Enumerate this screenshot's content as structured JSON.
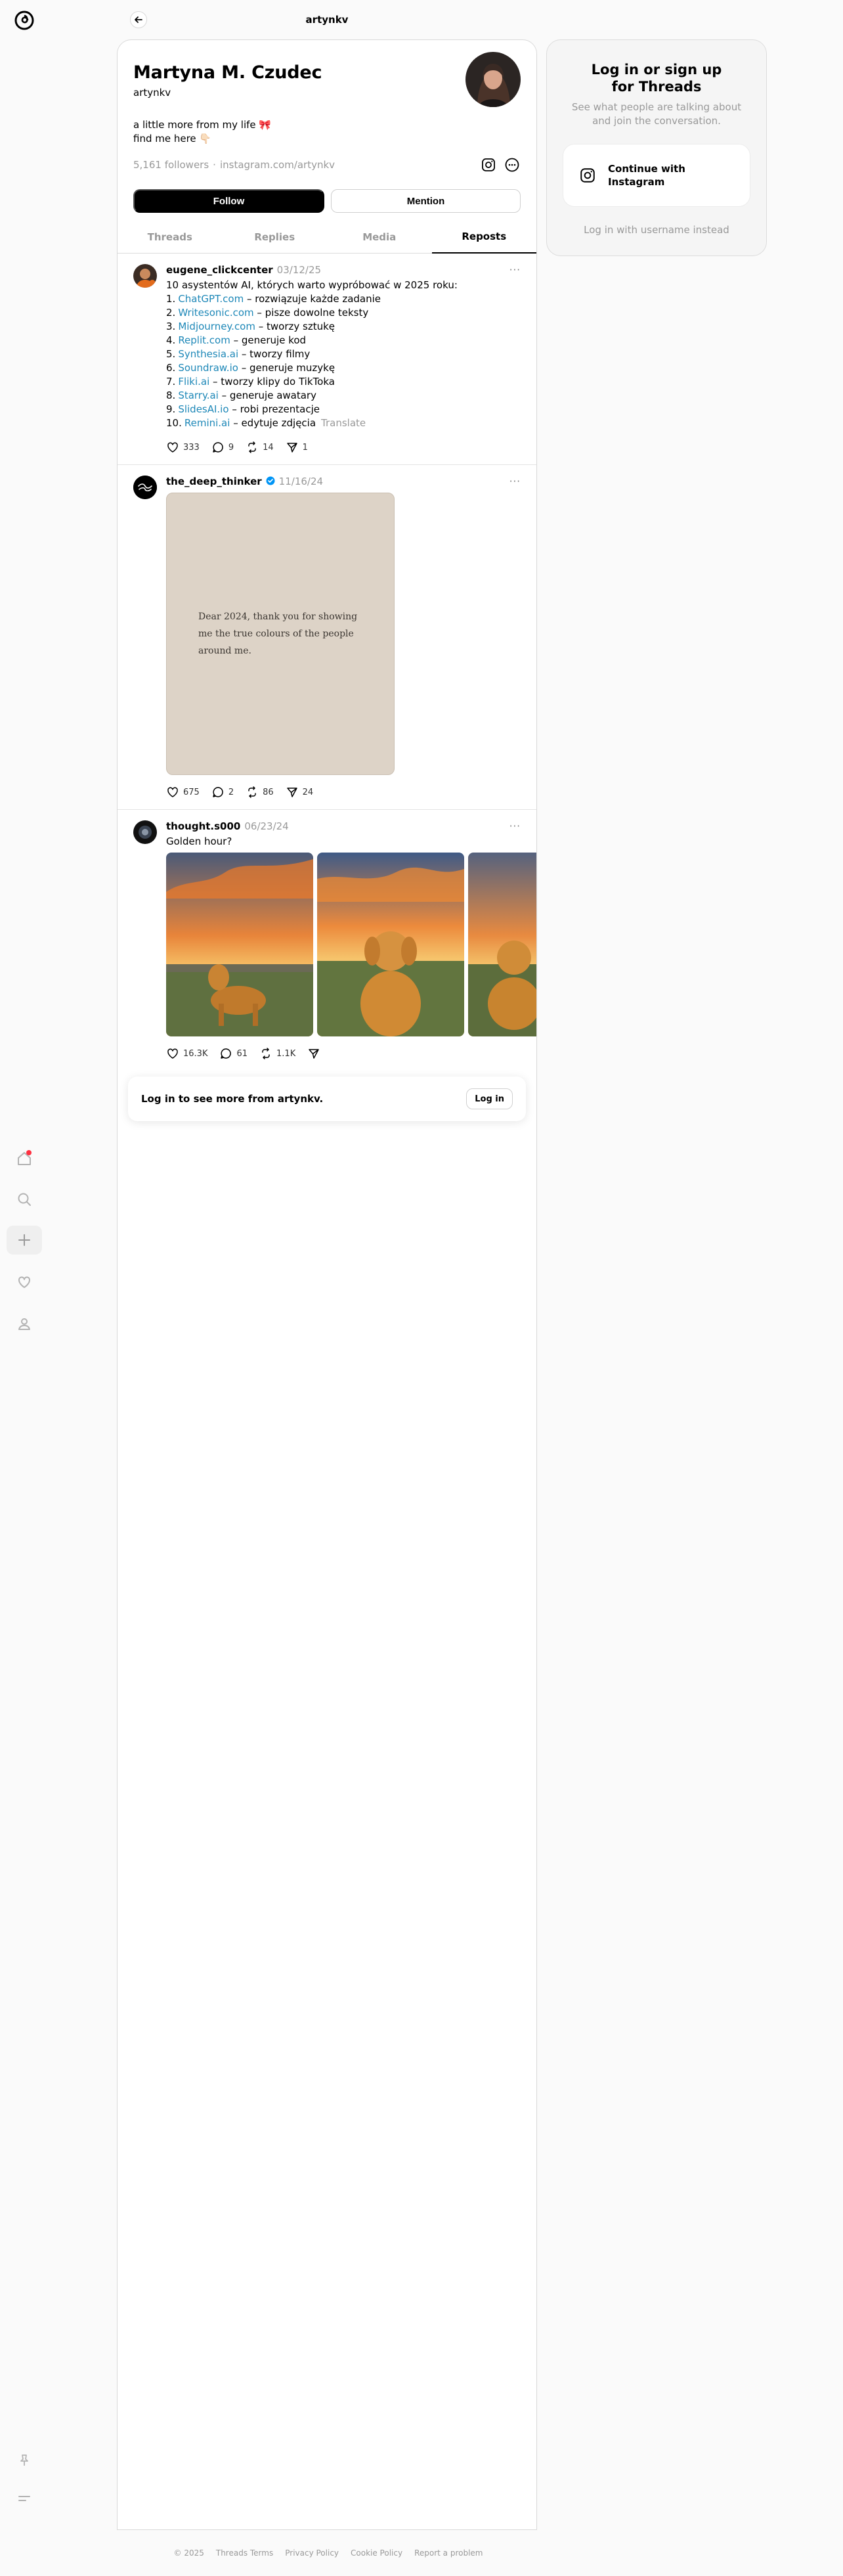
{
  "topbar": {
    "title": "artynkv"
  },
  "profile": {
    "name": "Martyna M. Czudec",
    "handle": "artynkv",
    "bio": "a little more from my life 🎀\nfind me here 👇🏻",
    "followers": "5,161 followers",
    "separator": "·",
    "link": "instagram.com/artynkv",
    "follow_label": "Follow",
    "mention_label": "Mention"
  },
  "tabs": [
    {
      "label": "Threads"
    },
    {
      "label": "Replies"
    },
    {
      "label": "Media"
    },
    {
      "label": "Reposts"
    }
  ],
  "posts": [
    {
      "author": "eugene_clickcenter",
      "date": "03/12/25",
      "more": "···",
      "intro": "10 asystentów AI, których warto wypróbować w 2025 roku:",
      "items": [
        {
          "num": "1.",
          "link": "ChatGPT.com",
          "desc": " – rozwiązuje każde zadanie"
        },
        {
          "num": "2.",
          "link": "Writesonic.com",
          "desc": " – pisze dowolne teksty"
        },
        {
          "num": "3.",
          "link": "Midjourney.com",
          "desc": " – tworzy sztukę"
        },
        {
          "num": "4.",
          "link": "Replit.com",
          "desc": " – generuje kod"
        },
        {
          "num": "5.",
          "link": "Synthesia.ai",
          "desc": " – tworzy filmy"
        },
        {
          "num": "6.",
          "link": "Soundraw.io",
          "desc": " – generuje muzykę"
        },
        {
          "num": "7.",
          "link": "Fliki.ai",
          "desc": " – tworzy klipy do TikToka"
        },
        {
          "num": "8.",
          "link": "Starry.ai",
          "desc": " – generuje awatary"
        },
        {
          "num": "9.",
          "link": "SlidesAI.io",
          "desc": " – robi prezentacje"
        },
        {
          "num": "10.",
          "link": "Remini.ai",
          "desc": " – edytuje zdjęcia"
        }
      ],
      "translate": "Translate",
      "likes": "333",
      "replies": "9",
      "reposts": "14",
      "shares": "1"
    },
    {
      "author": "the_deep_thinker",
      "date": "11/16/24",
      "more": "···",
      "image_text": "Dear 2024, thank you for showing me the true colours of the people around me.",
      "likes": "675",
      "replies": "2",
      "reposts": "86",
      "shares": "24"
    },
    {
      "author": "thought.s000",
      "date": "06/23/24",
      "more": "···",
      "text": "Golden hour?",
      "likes": "16.3K",
      "replies": "61",
      "reposts": "1.1K"
    }
  ],
  "login_banner": {
    "text": "Log in to see more from artynkv.",
    "button": "Log in"
  },
  "side": {
    "title": "Log in or sign up for Threads",
    "subtitle": "See what people are talking about and join the conversation.",
    "instagram_button": "Continue with Instagram",
    "username_link": "Log in with username instead"
  },
  "footer": [
    "© 2025",
    "Threads Terms",
    "Privacy Policy",
    "Cookie Policy",
    "Report a problem"
  ],
  "colors": {
    "link": "#1e88b8",
    "notification_dot": "#ff3040",
    "verified": "#0095f6"
  }
}
